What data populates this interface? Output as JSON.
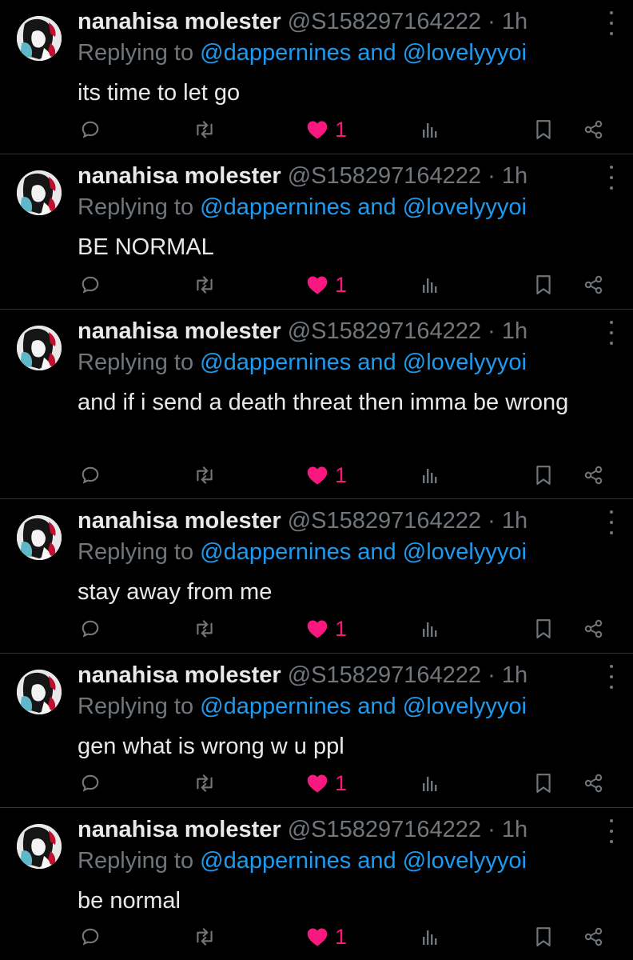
{
  "tweets": [
    {
      "name": "nanahisa molester",
      "handle": "@S158297164222",
      "sep": "·",
      "time": "1h",
      "replying_prefix": "Replying to",
      "reply_user1": "@dappernines",
      "reply_and": "and",
      "reply_user2": "@lovelyyyoi",
      "text": "its time to let go",
      "likes": "1"
    },
    {
      "name": "nanahisa molester",
      "handle": "@S158297164222",
      "sep": "·",
      "time": "1h",
      "replying_prefix": "Replying to",
      "reply_user1": "@dappernines",
      "reply_and": "and",
      "reply_user2": "@lovelyyyoi",
      "text": "BE NORMAL",
      "likes": "1"
    },
    {
      "name": "nanahisa molester",
      "handle": "@S158297164222",
      "sep": "·",
      "time": "1h",
      "replying_prefix": "Replying to",
      "reply_user1": "@dappernines",
      "reply_and": "and",
      "reply_user2": "@lovelyyyoi",
      "text": "and if i send a death threat then imma be wrong",
      "likes": "1"
    },
    {
      "name": "nanahisa molester",
      "handle": "@S158297164222",
      "sep": "·",
      "time": "1h",
      "replying_prefix": "Replying to",
      "reply_user1": "@dappernines",
      "reply_and": "and",
      "reply_user2": "@lovelyyyoi",
      "text": "stay away from me",
      "likes": "1"
    },
    {
      "name": "nanahisa molester",
      "handle": "@S158297164222",
      "sep": "·",
      "time": "1h",
      "replying_prefix": "Replying to",
      "reply_user1": "@dappernines",
      "reply_and": "and",
      "reply_user2": "@lovelyyyoi",
      "text": "gen what is wrong w u ppl",
      "likes": "1"
    },
    {
      "name": "nanahisa molester",
      "handle": "@S158297164222",
      "sep": "·",
      "time": "1h",
      "replying_prefix": "Replying to",
      "reply_user1": "@dappernines",
      "reply_and": "and",
      "reply_user2": "@lovelyyyoi",
      "text": "be normal",
      "likes": "1"
    }
  ],
  "icons": {
    "avatar": "avatar-image",
    "more": "more-options-icon",
    "reply": "reply-icon",
    "retweet": "retweet-icon",
    "like": "heart-icon",
    "views": "views-icon",
    "bookmark": "bookmark-icon",
    "share": "share-icon"
  },
  "colors": {
    "background": "#000000",
    "text": "#e7e9ea",
    "muted": "#71767b",
    "link": "#1d9bf0",
    "like": "#f91880",
    "divider": "#2f3336"
  }
}
